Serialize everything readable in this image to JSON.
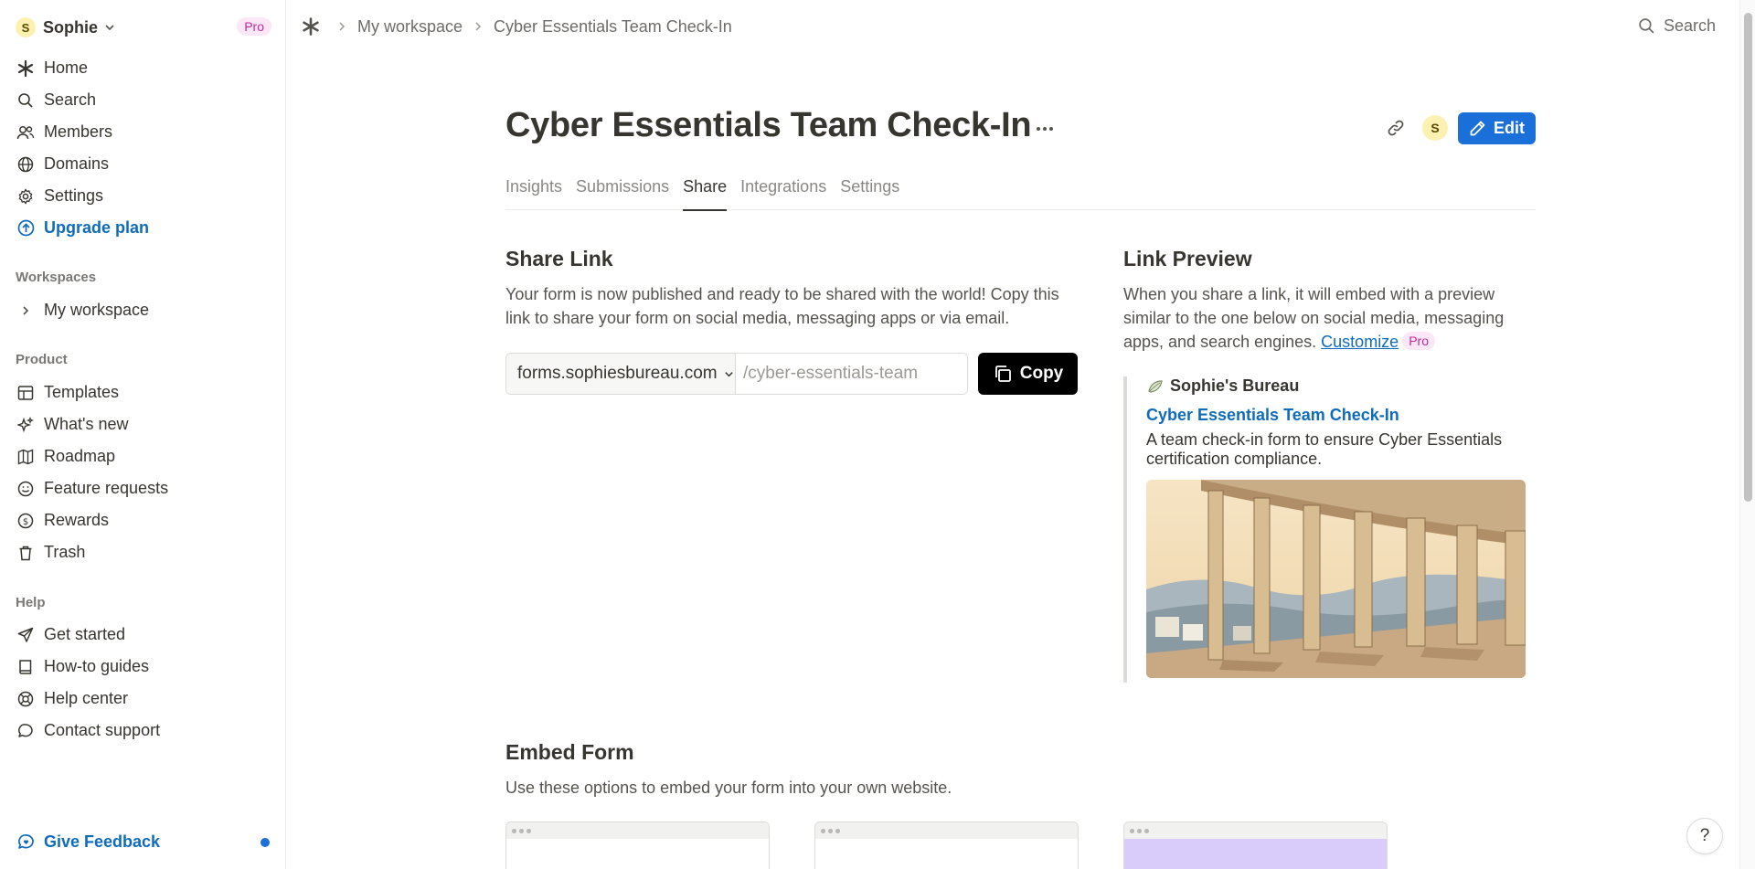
{
  "sidebar": {
    "workspace": {
      "initial": "S",
      "name": "Sophie",
      "badge": "Pro"
    },
    "nav": [
      {
        "label": "Home",
        "icon": "home-icon"
      },
      {
        "label": "Search",
        "icon": "search-icon"
      },
      {
        "label": "Members",
        "icon": "members-icon"
      },
      {
        "label": "Domains",
        "icon": "globe-icon"
      },
      {
        "label": "Settings",
        "icon": "gear-icon"
      },
      {
        "label": "Upgrade plan",
        "icon": "upgrade-icon"
      }
    ],
    "workspaces_label": "Workspaces",
    "workspace_item": "My workspace",
    "product_label": "Product",
    "product": [
      {
        "label": "Templates",
        "icon": "templates-icon"
      },
      {
        "label": "What's new",
        "icon": "sparkle-icon"
      },
      {
        "label": "Roadmap",
        "icon": "map-icon"
      },
      {
        "label": "Feature requests",
        "icon": "smile-icon"
      },
      {
        "label": "Rewards",
        "icon": "coin-icon"
      },
      {
        "label": "Trash",
        "icon": "trash-icon"
      }
    ],
    "help_label": "Help",
    "help": [
      {
        "label": "Get started",
        "icon": "send-icon"
      },
      {
        "label": "How-to guides",
        "icon": "book-icon"
      },
      {
        "label": "Help center",
        "icon": "lifebuoy-icon"
      },
      {
        "label": "Contact support",
        "icon": "chat-icon"
      }
    ],
    "feedback": "Give Feedback"
  },
  "topbar": {
    "breadcrumb": [
      "My workspace",
      "Cyber Essentials Team Check-In"
    ],
    "search": "Search"
  },
  "page": {
    "title": "Cyber Essentials Team Check-In",
    "owner_initial": "S",
    "edit_label": "Edit",
    "tabs": [
      "Insights",
      "Submissions",
      "Share",
      "Integrations",
      "Settings"
    ],
    "active_tab": "Share"
  },
  "share": {
    "heading": "Share Link",
    "description": "Your form is now published and ready to be shared with the world! Copy this link to share your form on social media, messaging apps or via email.",
    "domain": "forms.sophiesbureau.com",
    "slug": "/cyber-essentials-team",
    "copy_label": "Copy"
  },
  "preview": {
    "heading": "Link Preview",
    "description": "When you share a link, it will embed with a preview similar to the one below on social media, messaging apps, and search engines.",
    "customize": "Customize",
    "pro": "Pro",
    "site_name": "Sophie's Bureau",
    "title": "Cyber Essentials Team Check-In",
    "summary": "A team check-in form to ensure Cyber Essentials certification compliance."
  },
  "embed": {
    "heading": "Embed Form",
    "description": "Use these options to embed your form into your own website."
  },
  "help_button": "?",
  "colors": {
    "accent": "#1a6fd8",
    "link": "#0f6cbd",
    "pro_bg": "#fbe7f6",
    "pro_text": "#c02c9f"
  }
}
